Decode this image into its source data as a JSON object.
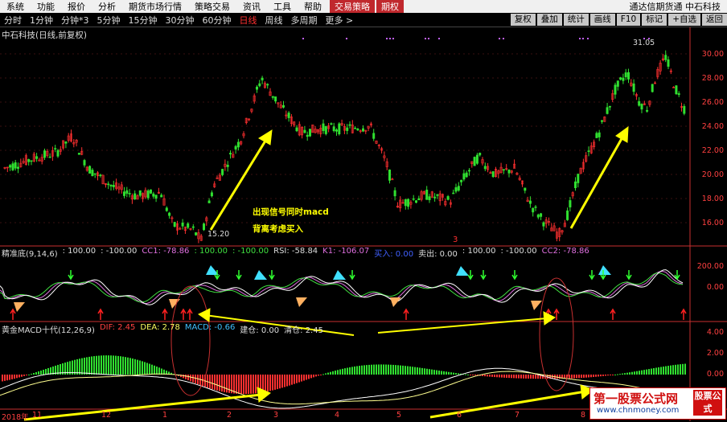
{
  "menu": {
    "items": [
      "系统",
      "功能",
      "报价",
      "分析",
      "期货市场行情",
      "策略交易",
      "资讯",
      "工具",
      "帮助"
    ],
    "highlight_items": [
      "交易策略",
      "期权"
    ],
    "right_text": "通达信期货通  中石科技"
  },
  "periods": {
    "tabs": [
      "分时",
      "1分钟",
      "分钟*3",
      "5分钟",
      "15分钟",
      "30分钟",
      "60分钟",
      "日线",
      "周线",
      "多周期",
      "更多 >"
    ],
    "active": "日线",
    "right_buttons": [
      "复权",
      "叠加",
      "统计",
      "画线",
      "F10",
      "标记",
      "+自选",
      "返回"
    ]
  },
  "price_pane": {
    "title": "中石科技(日线,前复权)",
    "y_ticks": [
      "30.00",
      "28.00",
      "26.00",
      "24.00",
      "22.00",
      "20.00",
      "18.00",
      "16.00"
    ],
    "low_label": "15.20",
    "high_label": "31.05",
    "annotation1": "出现信号同时macd",
    "annotation2": "背离考虑买入",
    "marker": "3"
  },
  "indicator_pane": {
    "title": "精准底(9,14,6)",
    "values": [
      {
        "text": "精准底(9,14,6)",
        "color": "#dddddd"
      },
      {
        "text": ": 100.00",
        "color": "#dddddd"
      },
      {
        "text": ": -100.00",
        "color": "#dddddd"
      },
      {
        "text": "CC1: -78.86",
        "color": "#e070e0"
      },
      {
        "text": ": 100.00",
        "color": "#40e040"
      },
      {
        "text": ": -100.00",
        "color": "#40e040"
      },
      {
        "text": "RSI: -58.84",
        "color": "#dddddd"
      },
      {
        "text": "K1: -106.07",
        "color": "#e070e0"
      },
      {
        "text": "买入: 0.00",
        "color": "#4060ff"
      },
      {
        "text": "卖出: 0.00",
        "color": "#dddddd"
      },
      {
        "text": ": 100.00",
        "color": "#dddddd"
      },
      {
        "text": ": -100.00",
        "color": "#dddddd"
      },
      {
        "text": "CC2: -78.86",
        "color": "#e070e0"
      }
    ],
    "y_ticks": [
      "200.00",
      "0.00"
    ]
  },
  "macd_pane": {
    "title": "黄金MACD十代(12,26,9)",
    "dif": "DIF: 2.45",
    "dea": "DEA: 2.78",
    "macd": "MACD: -0.66",
    "build": "建仓: 0.00",
    "clear": "清仓: 2.45",
    "y_ticks": [
      "4.00",
      "2.00",
      "0.00"
    ]
  },
  "x_axis": {
    "labels": [
      "2018年",
      "11",
      "12",
      "1",
      "2",
      "3",
      "4",
      "5",
      "6",
      "7",
      "8"
    ]
  },
  "watermark": {
    "main": "第一股票公式网",
    "url": "www.chnmoney.com",
    "badge": "股票公式"
  },
  "colors": {
    "up": "#ff3030",
    "down": "#30e030",
    "arrow": "#ffff00",
    "axis": "#c83030"
  }
}
